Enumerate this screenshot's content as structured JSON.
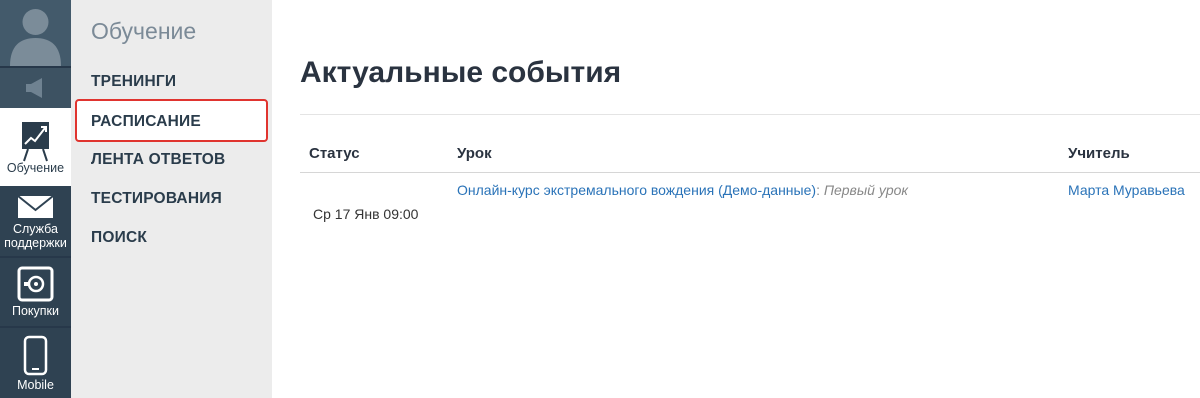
{
  "rail": {
    "items": [
      {
        "label": "Обучение"
      },
      {
        "label": "Служба поддержки"
      },
      {
        "label": "Покупки"
      },
      {
        "label": "Mobile"
      }
    ]
  },
  "subnav": {
    "title": "Обучение",
    "items": [
      {
        "label": "ТРЕНИНГИ"
      },
      {
        "label": "РАСПИСАНИЕ"
      },
      {
        "label": "ЛЕНТА ОТВЕТОВ"
      },
      {
        "label": "ТЕСТИРОВАНИЯ"
      },
      {
        "label": "ПОИСК"
      }
    ]
  },
  "main": {
    "title": "Актуальные события",
    "table": {
      "headers": [
        "Статус",
        "Урок",
        "Учитель"
      ],
      "rows": [
        {
          "date": "Ср 17 Янв 09:00",
          "course": "Онлайн-курс экстремального вождения (Демо-данные)",
          "separator": ":",
          "lesson": "Первый урок",
          "teacher": "Марта Муравьева"
        }
      ]
    }
  },
  "colors": {
    "rail_bg": "#2f4252",
    "subnav_bg": "#ececec",
    "highlight": "#e0342f",
    "link": "#2a73b8"
  }
}
